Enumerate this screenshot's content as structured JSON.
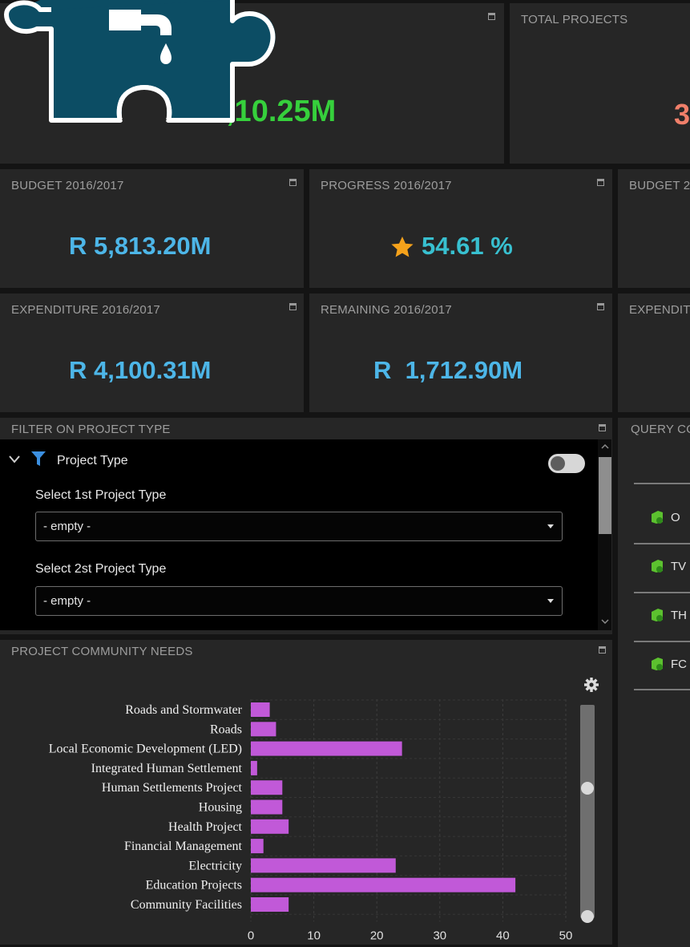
{
  "app_logo": {
    "name": "water-puzzle-logo"
  },
  "tiles": {
    "top_left": {
      "value": ",10.25M"
    },
    "total_projects": {
      "title": "TOTAL PROJECTS",
      "value": "3"
    },
    "budget": {
      "title": "BUDGET 2016/2017",
      "value": "R 5,813.20M"
    },
    "progress": {
      "title": "PROGRESS 2016/2017",
      "value": "54.61 %"
    },
    "budget_cut": {
      "title": "BUDGET 2"
    },
    "expenditure": {
      "title": "EXPENDITURE 2016/2017",
      "value": "R 4,100.31M"
    },
    "remaining": {
      "title": "REMAINING 2016/2017",
      "value": "R  1,712.90M"
    },
    "expenditure_cut": {
      "title": "EXPENDIT"
    }
  },
  "filter": {
    "title": "FILTER ON PROJECT TYPE",
    "group_label": "Project Type",
    "select1_label": "Select 1st Project Type",
    "select1_value": "- empty -",
    "select2_label": "Select 2st Project Type",
    "select2_value": "- empty -"
  },
  "query": {
    "title": "QUERY CO",
    "items": [
      "O",
      "TV",
      "TH",
      "FC"
    ]
  },
  "needs": {
    "title": "PROJECT COMMUNITY NEEDS"
  },
  "colors": {
    "bar": "#c159d8",
    "value_blue": "#4db6e8",
    "value_green": "#36d03c",
    "star": "#f5a21b",
    "salmon": "#f07f6a"
  },
  "chart_data": {
    "type": "bar",
    "orientation": "horizontal",
    "categories": [
      "Roads and Stormwater",
      "Roads",
      "Local Economic Development (LED)",
      "Integrated Human Settlement",
      "Human Settlements Project",
      "Housing",
      "Health Project",
      "Financial Management",
      "Electricity",
      "Education Projects",
      "Community Facilities"
    ],
    "values": [
      3,
      4,
      24,
      1,
      5,
      5,
      6,
      2,
      23,
      42,
      6
    ],
    "xlim": [
      0,
      50
    ],
    "xticks": [
      "0",
      "10",
      "20",
      "30",
      "40",
      "50"
    ],
    "grid": true
  }
}
